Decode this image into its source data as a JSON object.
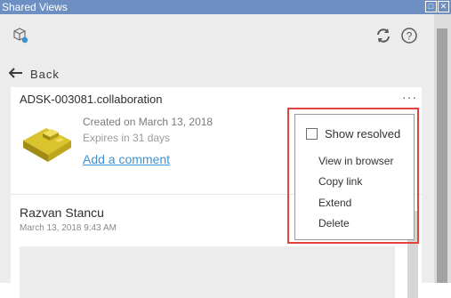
{
  "window": {
    "title": "Shared Views",
    "controls": {
      "restore": "□",
      "close": "✕"
    }
  },
  "toolbar": {
    "left_icon": "view-share-icon",
    "right_icons": [
      "refresh-icon",
      "help-icon"
    ]
  },
  "back": {
    "label": "Back",
    "icon": "arrow-left-icon"
  },
  "view_card": {
    "name": "ADSK-003081.collaboration",
    "more": "···",
    "created": "Created on March 13, 2018",
    "expires": "Expires in 31 days",
    "add_comment": "Add a comment",
    "thumbnail": "model-thumbnail"
  },
  "comment": {
    "author": "Razvan Stancu",
    "timestamp": "March 13, 2018 9:43 AM"
  },
  "menu": {
    "show_resolved": "Show resolved",
    "show_resolved_checked": false,
    "items": [
      "View in browser",
      "Copy link",
      "Extend",
      "Delete"
    ]
  },
  "colors": {
    "titlebar": "#6d8fc2",
    "link": "#3e91cf",
    "highlight": "#e0443a",
    "background": "#ececec"
  }
}
